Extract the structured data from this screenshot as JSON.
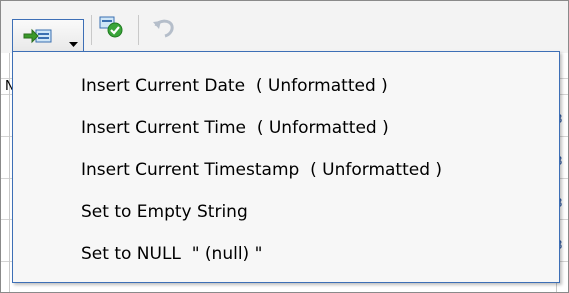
{
  "toolbar": {
    "icons": [
      "insert-value-icon",
      "chevron-down-icon",
      "validate-icon",
      "undo-icon"
    ],
    "colors": {
      "border_accent": "#3d6fb6",
      "arrow_green": "#3a9a2a",
      "check_green": "#3aa53a"
    }
  },
  "menu": {
    "items": [
      {
        "label": "Insert Current Date  ( Unformatted )"
      },
      {
        "label": "Insert Current Time  ( Unformatted )"
      },
      {
        "label": "Insert Current Timestamp  ( Unformatted )"
      },
      {
        "label": "Set to Empty String"
      },
      {
        "label": "Set to NULL  \" (null) \""
      }
    ]
  },
  "grid": {
    "left_fragment": "N",
    "right_fragment": "8"
  }
}
